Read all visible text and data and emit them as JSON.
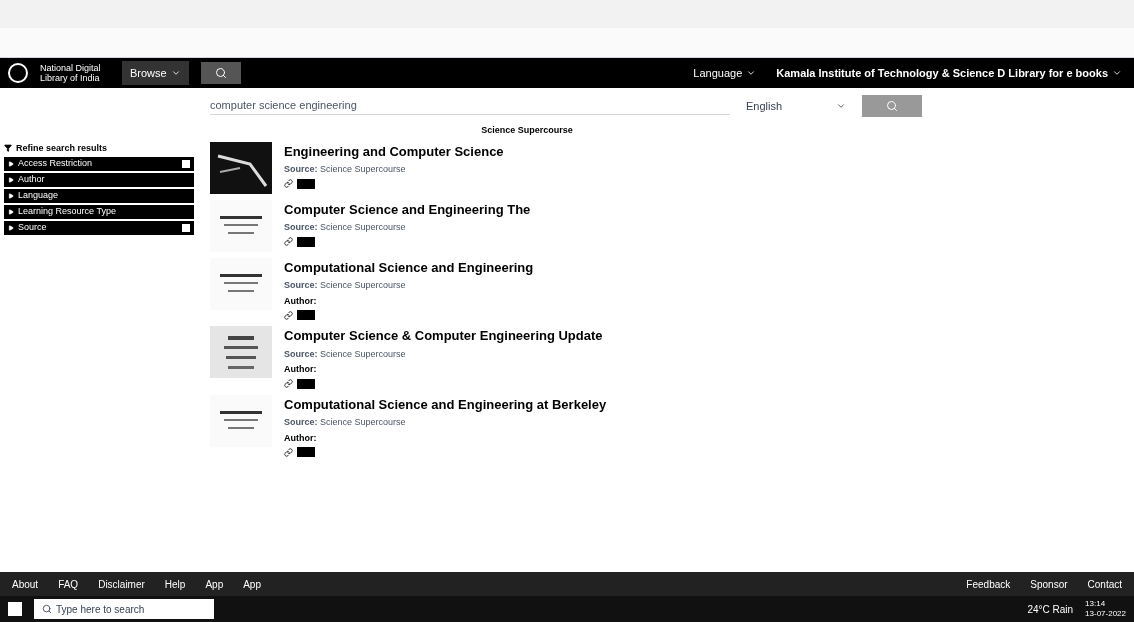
{
  "navbar": {
    "logo_text": "National Digital Library of India",
    "browse": "Browse",
    "language": "Language",
    "user": "Kamala Institute of Technology & Science D Library for e books"
  },
  "search": {
    "value": "computer science engineering",
    "language": "English"
  },
  "source_heading": "Science Supercourse",
  "filters": {
    "title": "Refine search results",
    "items": [
      {
        "label": "Access Restriction",
        "badge": true
      },
      {
        "label": "Author",
        "badge": false
      },
      {
        "label": "Language",
        "badge": false
      },
      {
        "label": "Learning Resource Type",
        "badge": false
      },
      {
        "label": "Source",
        "badge": true
      }
    ]
  },
  "results": [
    {
      "title": "Engineering and Computer Science",
      "source": "**Source:** Science Supercourse",
      "kind": "dark"
    },
    {
      "title": "Computer Science and Engineering The",
      "source": "**Source:** Science Supercourse",
      "kind": "light"
    },
    {
      "title": "Computational Science and Engineering",
      "source": "**Source:** Science Supercourse",
      "author": "Author:",
      "kind": "light"
    },
    {
      "title": "Computer Science & Computer Engineering Update",
      "source": "**Source:** Science Supercourse",
      "author": "Author:",
      "kind": "dotted"
    },
    {
      "title": "Computational Science and Engineering at Berkeley",
      "source": "**Source:** Science Supercourse",
      "author": "Author:",
      "kind": "light"
    }
  ],
  "footer": {
    "links": [
      "About",
      "FAQ",
      "Disclaimer",
      "Help",
      "App",
      "App"
    ],
    "right_links": [
      "Feedback",
      "Sponsor",
      "Contact"
    ]
  },
  "taskbar": {
    "search_placeholder": "Type here to search",
    "weather": "24°C Rain",
    "time": "13:14",
    "date": "13-07-2022"
  }
}
